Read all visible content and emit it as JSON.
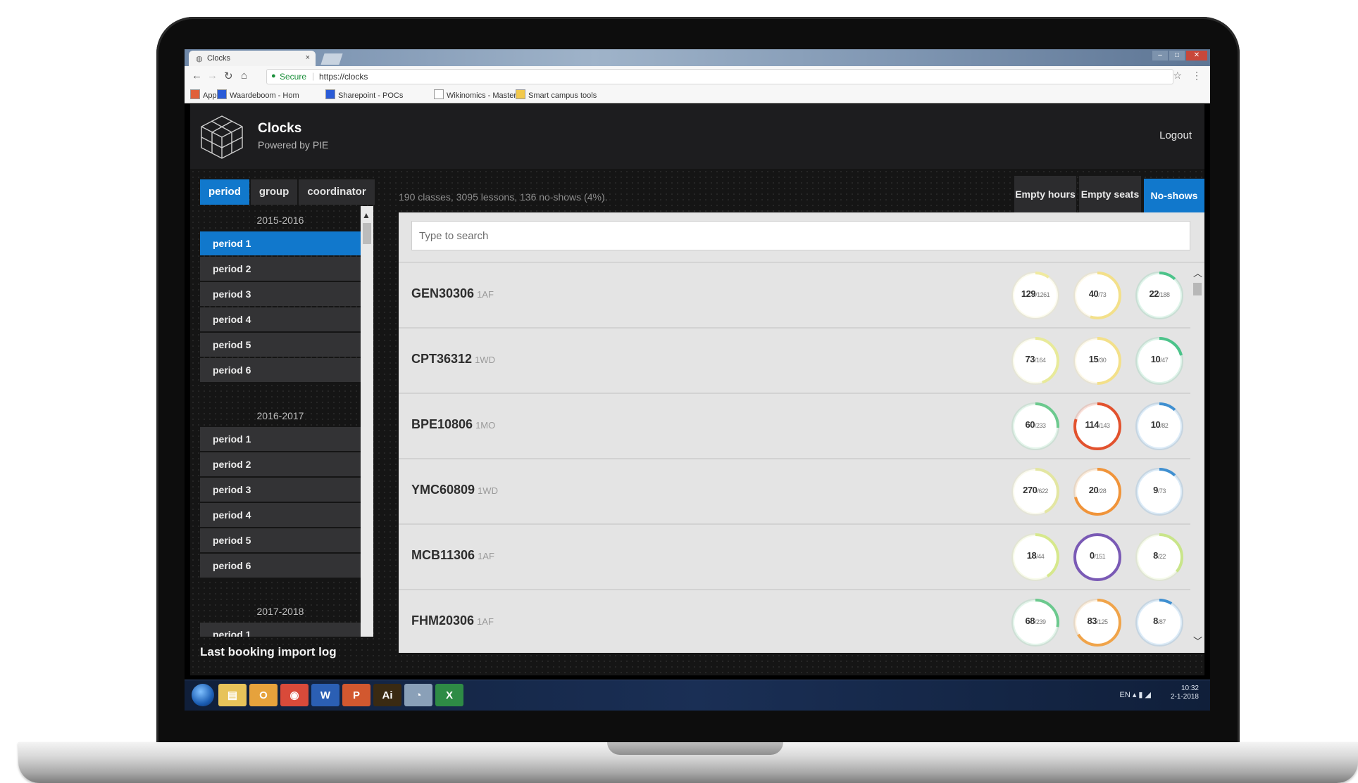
{
  "browser": {
    "tab_title": "Clocks",
    "tab_close": "×",
    "secure_label": "Secure",
    "url": "https://clocks",
    "bookmarks": [
      {
        "label": "Apps",
        "color": "#e0603a"
      },
      {
        "label": "Waardeboom - Hom",
        "color": "#2a5bd7"
      },
      {
        "label": "Sharepoint - POCs",
        "color": "#2a5bd7"
      },
      {
        "label": "Wikinomics - Master",
        "color": "#ffffff"
      },
      {
        "label": "Smart campus tools",
        "color": "#f2c94c"
      }
    ]
  },
  "app": {
    "title": "Clocks",
    "subtitle": "Powered by PIE",
    "logout": "Logout"
  },
  "sidebar": {
    "tabs": [
      {
        "label": "period",
        "active": true
      },
      {
        "label": "group",
        "active": false
      },
      {
        "label": "coordinator",
        "active": false
      }
    ],
    "years": [
      {
        "label": "2015-2016",
        "periods": [
          "period 1",
          "period 2",
          "period 3",
          "period 4",
          "period 5",
          "period 6"
        ],
        "active_index": 0
      },
      {
        "label": "2016-2017",
        "periods": [
          "period 1",
          "period 2",
          "period 3",
          "period 4",
          "period 5",
          "period 6"
        ],
        "active_index": -1
      },
      {
        "label": "2017-2018",
        "periods": [
          "period 1"
        ],
        "active_index": -1
      }
    ],
    "import_log_title": "Last booking import log"
  },
  "main": {
    "summary": "190 classes, 3095 lessons, 136 no-shows (4%).",
    "view_tabs": [
      {
        "label": "Empty hours",
        "active": false
      },
      {
        "label": "Empty seats",
        "active": false
      },
      {
        "label": "No-shows",
        "active": true
      }
    ],
    "search_placeholder": "Type to search",
    "rows": [
      {
        "code": "GEN30306",
        "suffix": "1AF",
        "clocks": [
          {
            "value": "129",
            "total": "1261",
            "fraction": 0.1,
            "color": "#f0eaa0"
          },
          {
            "value": "40",
            "total": "73",
            "fraction": 0.55,
            "color": "#f3e08a"
          },
          {
            "value": "22",
            "total": "188",
            "fraction": 0.12,
            "color": "#4cc38a"
          }
        ]
      },
      {
        "code": "CPT36312",
        "suffix": "1WD",
        "clocks": [
          {
            "value": "73",
            "total": "164",
            "fraction": 0.45,
            "color": "#e8ea9a"
          },
          {
            "value": "15",
            "total": "30",
            "fraction": 0.5,
            "color": "#f3e08a"
          },
          {
            "value": "10",
            "total": "47",
            "fraction": 0.21,
            "color": "#4cc38a"
          }
        ]
      },
      {
        "code": "BPE10806",
        "suffix": "1MO",
        "clocks": [
          {
            "value": "60",
            "total": "233",
            "fraction": 0.26,
            "color": "#6cc98e"
          },
          {
            "value": "114",
            "total": "143",
            "fraction": 0.8,
            "color": "#e2522e"
          },
          {
            "value": "10",
            "total": "82",
            "fraction": 0.12,
            "color": "#3f8fd0"
          }
        ]
      },
      {
        "code": "YMC60809",
        "suffix": "1WD",
        "clocks": [
          {
            "value": "270",
            "total": "622",
            "fraction": 0.43,
            "color": "#e3e6a2"
          },
          {
            "value": "20",
            "total": "28",
            "fraction": 0.71,
            "color": "#f0943a"
          },
          {
            "value": "9",
            "total": "73",
            "fraction": 0.12,
            "color": "#3f8fd0"
          }
        ]
      },
      {
        "code": "MCB11306",
        "suffix": "1AF",
        "clocks": [
          {
            "value": "18",
            "total": "44",
            "fraction": 0.41,
            "color": "#d6e88c"
          },
          {
            "value": "0",
            "total": "151",
            "fraction": 1.0,
            "color": "#7a5ab5"
          },
          {
            "value": "8",
            "total": "22",
            "fraction": 0.36,
            "color": "#c9e58a"
          }
        ]
      },
      {
        "code": "FHM20306",
        "suffix": "1AF",
        "clocks": [
          {
            "value": "68",
            "total": "239",
            "fraction": 0.28,
            "color": "#6cc98e"
          },
          {
            "value": "83",
            "total": "125",
            "fraction": 0.66,
            "color": "#f0a44a"
          },
          {
            "value": "8",
            "total": "87",
            "fraction": 0.09,
            "color": "#3f8fd0"
          }
        ]
      }
    ]
  },
  "taskbar": {
    "apps": [
      {
        "name": "explorer",
        "glyph": "▤",
        "color": "#e7c35a"
      },
      {
        "name": "outlook",
        "glyph": "O",
        "color": "#e6a23c"
      },
      {
        "name": "chrome",
        "glyph": "◉",
        "color": "#d94a3a"
      },
      {
        "name": "word",
        "glyph": "W",
        "color": "#2b5fb4"
      },
      {
        "name": "powerpoint",
        "glyph": "P",
        "color": "#d2582f"
      },
      {
        "name": "illustrator",
        "glyph": "Ai",
        "color": "#3a2a12"
      },
      {
        "name": "tool",
        "glyph": "◔",
        "color": "#8aa0b8"
      },
      {
        "name": "excel",
        "glyph": "X",
        "color": "#2e8b45"
      }
    ],
    "lang": "EN",
    "time": "10:32",
    "date": "2-1-2018"
  },
  "colors": {
    "accent": "#1178cc",
    "app_bg": "#151515",
    "panel_bg": "#e4e4e4"
  }
}
